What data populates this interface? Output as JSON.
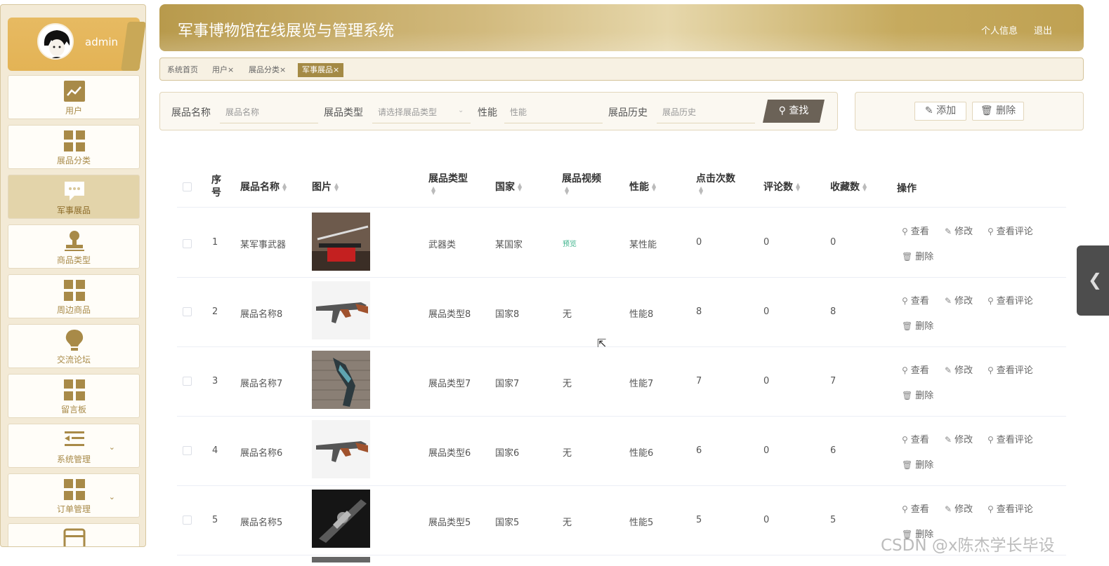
{
  "user": {
    "name": "admin"
  },
  "header": {
    "title": "军事博物馆在线展览与管理系统",
    "profile_link": "个人信息",
    "logout_link": "退出"
  },
  "sidebar": {
    "items": [
      {
        "label": "用户",
        "icon": "chart-line-icon",
        "active": false
      },
      {
        "label": "展品分类",
        "icon": "grid-icon",
        "active": false
      },
      {
        "label": "军事展品",
        "icon": "chat-bubble-icon",
        "active": true
      },
      {
        "label": "商品类型",
        "icon": "stamp-icon",
        "active": false
      },
      {
        "label": "周边商品",
        "icon": "grid-icon",
        "active": false
      },
      {
        "label": "交流论坛",
        "icon": "bulb-icon",
        "active": false
      },
      {
        "label": "留言板",
        "icon": "grid-icon",
        "active": false
      },
      {
        "label": "系统管理",
        "icon": "list-icon",
        "active": false
      },
      {
        "label": "订单管理",
        "icon": "grid-icon",
        "active": false
      }
    ]
  },
  "tabs": [
    {
      "label": "系统首页"
    },
    {
      "label": "用户",
      "close": "×"
    },
    {
      "label": "展品分类",
      "close": "×"
    },
    {
      "label": "军事展品",
      "close": "×",
      "active": true
    }
  ],
  "search": {
    "name_label": "展品名称",
    "name_placeholder": "展品名称",
    "type_label": "展品类型",
    "type_placeholder": "请选择展品类型",
    "perf_label": "性能",
    "perf_placeholder": "性能",
    "history_label": "展品历史",
    "history_placeholder": "展品历史",
    "search_button": "查找"
  },
  "actions": {
    "add": "添加",
    "delete": "删除"
  },
  "table": {
    "headers": {
      "index": "序号",
      "name": "展品名称",
      "image": "图片",
      "type": "展品类型",
      "country": "国家",
      "video": "展品视频",
      "performance": "性能",
      "clicks": "点击次数",
      "comments": "评论数",
      "favorites": "收藏数",
      "operations": "操作"
    },
    "rows": [
      {
        "index": "1",
        "name": "某军事武器",
        "type": "武器类",
        "country": "某国家",
        "video": "预览",
        "performance": "某性能",
        "clicks": "0",
        "comments": "0",
        "favorites": "0"
      },
      {
        "index": "2",
        "name": "展品名称8",
        "type": "展品类型8",
        "country": "国家8",
        "video": "无",
        "performance": "性能8",
        "clicks": "8",
        "comments": "0",
        "favorites": "8"
      },
      {
        "index": "3",
        "name": "展品名称7",
        "type": "展品类型7",
        "country": "国家7",
        "video": "无",
        "performance": "性能7",
        "clicks": "7",
        "comments": "0",
        "favorites": "7"
      },
      {
        "index": "4",
        "name": "展品名称6",
        "type": "展品类型6",
        "country": "国家6",
        "video": "无",
        "performance": "性能6",
        "clicks": "6",
        "comments": "0",
        "favorites": "6"
      },
      {
        "index": "5",
        "name": "展品名称5",
        "type": "展品类型5",
        "country": "国家5",
        "video": "无",
        "performance": "性能5",
        "clicks": "5",
        "comments": "0",
        "favorites": "5"
      }
    ],
    "ops": {
      "view": "查看",
      "edit": "修改",
      "view_comments": "查看评论",
      "delete": "删除"
    }
  },
  "watermark": "CSDN @x陈杰学长毕设",
  "colors": {
    "accent": "#c4a55a",
    "sidebar_bg": "#f3ead6",
    "active_item": "#e3d4aa",
    "search_button": "#6b6257"
  }
}
